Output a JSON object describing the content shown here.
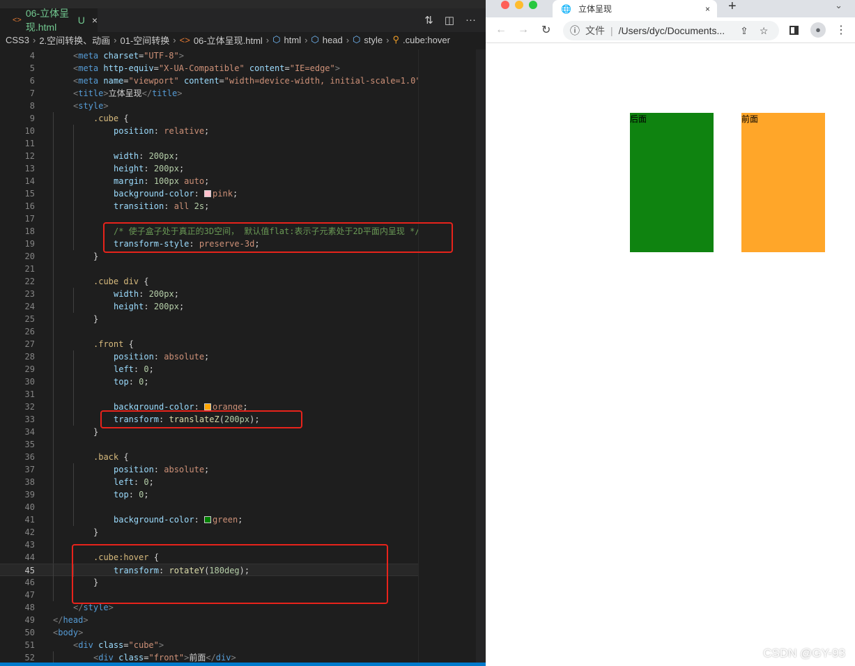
{
  "editor": {
    "tab": {
      "icon": "code-file-icon",
      "label": "06-立体呈现.html",
      "status": "U",
      "close": "×"
    },
    "breadcrumbs": [
      "CSS3",
      "2.空间转换、动画",
      "01-空间转换",
      "06-立体呈现.html",
      "html",
      "head",
      "style",
      ".cube:hover"
    ],
    "current_line": 45,
    "lines": [
      {
        "n": 4,
        "i": 1,
        "t": [
          [
            "p",
            "<"
          ],
          [
            "g",
            "meta"
          ],
          [
            "a",
            " charset"
          ],
          [
            "x",
            "="
          ],
          [
            "s",
            "\"UTF-8\""
          ],
          [
            "p",
            ">"
          ]
        ]
      },
      {
        "n": 5,
        "i": 1,
        "t": [
          [
            "p",
            "<"
          ],
          [
            "g",
            "meta"
          ],
          [
            "a",
            " http-equiv"
          ],
          [
            "x",
            "="
          ],
          [
            "s",
            "\"X-UA-Compatible\""
          ],
          [
            "a",
            " content"
          ],
          [
            "x",
            "="
          ],
          [
            "s",
            "\"IE=edge\""
          ],
          [
            "p",
            ">"
          ]
        ]
      },
      {
        "n": 6,
        "i": 1,
        "t": [
          [
            "p",
            "<"
          ],
          [
            "g",
            "meta"
          ],
          [
            "a",
            " name"
          ],
          [
            "x",
            "="
          ],
          [
            "s",
            "\"viewport\""
          ],
          [
            "a",
            " content"
          ],
          [
            "x",
            "="
          ],
          [
            "s",
            "\"width=device-width, initial-scale=1.0\""
          ]
        ]
      },
      {
        "n": 7,
        "i": 1,
        "t": [
          [
            "p",
            "<"
          ],
          [
            "g",
            "title"
          ],
          [
            "p",
            ">"
          ],
          [
            "x",
            "立体呈现"
          ],
          [
            "p",
            "</"
          ],
          [
            "g",
            "title"
          ],
          [
            "p",
            ">"
          ]
        ]
      },
      {
        "n": 8,
        "i": 1,
        "t": [
          [
            "p",
            "<"
          ],
          [
            "g",
            "style"
          ],
          [
            "p",
            ">"
          ]
        ]
      },
      {
        "n": 9,
        "i": 2,
        "t": [
          [
            "sel",
            ".cube"
          ],
          [
            "x",
            " {"
          ]
        ]
      },
      {
        "n": 10,
        "i": 3,
        "t": [
          [
            "pr",
            "position"
          ],
          [
            "x",
            ": "
          ],
          [
            "v",
            "relative"
          ],
          [
            "x",
            ";"
          ]
        ]
      },
      {
        "n": 11,
        "i": 3,
        "t": []
      },
      {
        "n": 12,
        "i": 3,
        "t": [
          [
            "pr",
            "width"
          ],
          [
            "x",
            ": "
          ],
          [
            "n",
            "200px"
          ],
          [
            "x",
            ";"
          ]
        ]
      },
      {
        "n": 13,
        "i": 3,
        "t": [
          [
            "pr",
            "height"
          ],
          [
            "x",
            ": "
          ],
          [
            "n",
            "200px"
          ],
          [
            "x",
            ";"
          ]
        ]
      },
      {
        "n": 14,
        "i": 3,
        "t": [
          [
            "pr",
            "margin"
          ],
          [
            "x",
            ": "
          ],
          [
            "n",
            "100px"
          ],
          [
            "v",
            " auto"
          ],
          [
            "x",
            ";"
          ]
        ]
      },
      {
        "n": 15,
        "i": 3,
        "t": [
          [
            "pr",
            "background-color"
          ],
          [
            "x",
            ": "
          ],
          [
            "sw",
            "#ffc0cb"
          ],
          [
            "v",
            "pink"
          ],
          [
            "x",
            ";"
          ]
        ]
      },
      {
        "n": 16,
        "i": 3,
        "t": [
          [
            "pr",
            "transition"
          ],
          [
            "x",
            ": "
          ],
          [
            "v",
            "all "
          ],
          [
            "n",
            "2s"
          ],
          [
            "x",
            ";"
          ]
        ]
      },
      {
        "n": 17,
        "i": 3,
        "t": []
      },
      {
        "n": 18,
        "i": 3,
        "t": [
          [
            "c",
            "/* 使子盒子处于真正的3D空间， 默认值flat:表示子元素处于2D平面内呈现 */"
          ]
        ]
      },
      {
        "n": 19,
        "i": 3,
        "t": [
          [
            "pr",
            "transform-style"
          ],
          [
            "x",
            ": "
          ],
          [
            "v",
            "preserve-3d"
          ],
          [
            "x",
            ";"
          ]
        ]
      },
      {
        "n": 20,
        "i": 2,
        "t": [
          [
            "x",
            "}"
          ]
        ]
      },
      {
        "n": 21,
        "i": 2,
        "t": []
      },
      {
        "n": 22,
        "i": 2,
        "t": [
          [
            "sel",
            ".cube div"
          ],
          [
            "x",
            " {"
          ]
        ]
      },
      {
        "n": 23,
        "i": 3,
        "t": [
          [
            "pr",
            "width"
          ],
          [
            "x",
            ": "
          ],
          [
            "n",
            "200px"
          ],
          [
            "x",
            ";"
          ]
        ]
      },
      {
        "n": 24,
        "i": 3,
        "t": [
          [
            "pr",
            "height"
          ],
          [
            "x",
            ": "
          ],
          [
            "n",
            "200px"
          ],
          [
            "x",
            ";"
          ]
        ]
      },
      {
        "n": 25,
        "i": 2,
        "t": [
          [
            "x",
            "}"
          ]
        ]
      },
      {
        "n": 26,
        "i": 2,
        "t": []
      },
      {
        "n": 27,
        "i": 2,
        "t": [
          [
            "sel",
            ".front"
          ],
          [
            "x",
            " {"
          ]
        ]
      },
      {
        "n": 28,
        "i": 3,
        "t": [
          [
            "pr",
            "position"
          ],
          [
            "x",
            ": "
          ],
          [
            "v",
            "absolute"
          ],
          [
            "x",
            ";"
          ]
        ]
      },
      {
        "n": 29,
        "i": 3,
        "t": [
          [
            "pr",
            "left"
          ],
          [
            "x",
            ": "
          ],
          [
            "n",
            "0"
          ],
          [
            "x",
            ";"
          ]
        ]
      },
      {
        "n": 30,
        "i": 3,
        "t": [
          [
            "pr",
            "top"
          ],
          [
            "x",
            ": "
          ],
          [
            "n",
            "0"
          ],
          [
            "x",
            ";"
          ]
        ]
      },
      {
        "n": 31,
        "i": 3,
        "t": []
      },
      {
        "n": 32,
        "i": 3,
        "t": [
          [
            "pr",
            "background-color"
          ],
          [
            "x",
            ": "
          ],
          [
            "sw",
            "#ffa500"
          ],
          [
            "v",
            "orange"
          ],
          [
            "x",
            ";"
          ]
        ]
      },
      {
        "n": 33,
        "i": 3,
        "t": [
          [
            "pr",
            "transform"
          ],
          [
            "x",
            ": "
          ],
          [
            "f",
            "translateZ"
          ],
          [
            "x",
            "("
          ],
          [
            "n",
            "200px"
          ],
          [
            "x",
            ");"
          ]
        ]
      },
      {
        "n": 34,
        "i": 2,
        "t": [
          [
            "x",
            "}"
          ]
        ]
      },
      {
        "n": 35,
        "i": 2,
        "t": []
      },
      {
        "n": 36,
        "i": 2,
        "t": [
          [
            "sel",
            ".back"
          ],
          [
            "x",
            " {"
          ]
        ]
      },
      {
        "n": 37,
        "i": 3,
        "t": [
          [
            "pr",
            "position"
          ],
          [
            "x",
            ": "
          ],
          [
            "v",
            "absolute"
          ],
          [
            "x",
            ";"
          ]
        ]
      },
      {
        "n": 38,
        "i": 3,
        "t": [
          [
            "pr",
            "left"
          ],
          [
            "x",
            ": "
          ],
          [
            "n",
            "0"
          ],
          [
            "x",
            ";"
          ]
        ]
      },
      {
        "n": 39,
        "i": 3,
        "t": [
          [
            "pr",
            "top"
          ],
          [
            "x",
            ": "
          ],
          [
            "n",
            "0"
          ],
          [
            "x",
            ";"
          ]
        ]
      },
      {
        "n": 40,
        "i": 3,
        "t": []
      },
      {
        "n": 41,
        "i": 3,
        "t": [
          [
            "pr",
            "background-color"
          ],
          [
            "x",
            ": "
          ],
          [
            "sw",
            "#008000"
          ],
          [
            "v",
            "green"
          ],
          [
            "x",
            ";"
          ]
        ]
      },
      {
        "n": 42,
        "i": 2,
        "t": [
          [
            "x",
            "}"
          ]
        ]
      },
      {
        "n": 43,
        "i": 2,
        "t": []
      },
      {
        "n": 44,
        "i": 2,
        "t": [
          [
            "sel",
            ".cube:hover"
          ],
          [
            "x",
            " {"
          ]
        ]
      },
      {
        "n": 45,
        "i": 3,
        "t": [
          [
            "pr",
            "transform"
          ],
          [
            "x",
            ": "
          ],
          [
            "f",
            "rotateY"
          ],
          [
            "x",
            "("
          ],
          [
            "n",
            "180deg"
          ],
          [
            "x",
            ");"
          ]
        ]
      },
      {
        "n": 46,
        "i": 2,
        "t": [
          [
            "x",
            "}"
          ]
        ]
      },
      {
        "n": 47,
        "i": 2,
        "t": []
      },
      {
        "n": 48,
        "i": 1,
        "t": [
          [
            "p",
            "</"
          ],
          [
            "g",
            "style"
          ],
          [
            "p",
            ">"
          ]
        ]
      },
      {
        "n": 49,
        "i": 0,
        "t": [
          [
            "p",
            "</"
          ],
          [
            "g",
            "head"
          ],
          [
            "p",
            ">"
          ]
        ]
      },
      {
        "n": 50,
        "i": 0,
        "t": [
          [
            "p",
            "<"
          ],
          [
            "g",
            "body"
          ],
          [
            "p",
            ">"
          ]
        ]
      },
      {
        "n": 51,
        "i": 1,
        "t": [
          [
            "p",
            "<"
          ],
          [
            "g",
            "div"
          ],
          [
            "a",
            " class"
          ],
          [
            "x",
            "="
          ],
          [
            "s",
            "\"cube\""
          ],
          [
            "p",
            ">"
          ]
        ]
      },
      {
        "n": 52,
        "i": 2,
        "t": [
          [
            "p",
            "<"
          ],
          [
            "g",
            "div"
          ],
          [
            "a",
            " class"
          ],
          [
            "x",
            "="
          ],
          [
            "s",
            "\"front\""
          ],
          [
            "p",
            ">"
          ],
          [
            "x",
            "前面"
          ],
          [
            "p",
            "</"
          ],
          [
            "g",
            "div"
          ],
          [
            "p",
            ">"
          ]
        ]
      }
    ],
    "highlight_boxes": [
      [
        18,
        19
      ],
      [
        33,
        33
      ],
      [
        44,
        46
      ]
    ],
    "highlight_color": "#e8231b"
  },
  "browser": {
    "tab_title": "立体呈现",
    "tab_close": "×",
    "new_tab": "+",
    "address": {
      "security_label": "文件",
      "url": "/Users/dyc/Documents..."
    },
    "page": {
      "back_label": "后面",
      "front_label": "前面",
      "back_color": "#0f8310",
      "front_color": "#ffa629"
    }
  },
  "watermark": "CSDN @GY-93"
}
